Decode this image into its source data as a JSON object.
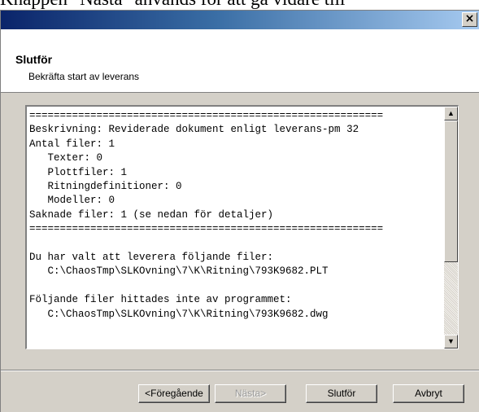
{
  "background_text": "Knappen \"Nästa\" används för att gå vidare till",
  "window": {
    "close_label": "×"
  },
  "header": {
    "title": "Slutför",
    "subtitle": "Bekräfta start av leverans"
  },
  "summary_lines": [
    "==========================================================",
    "Beskrivning: Reviderade dokument enligt leverans-pm 32",
    "Antal filer: 1",
    "   Texter: 0",
    "   Plottfiler: 1",
    "   Ritningdefinitioner: 0",
    "   Modeller: 0",
    "Saknade filer: 1 (se nedan för detaljer)",
    "==========================================================",
    "",
    "Du har valt att leverera följande filer:",
    "   C:\\ChaosTmp\\SLKOvning\\7\\K\\Ritning\\793K9682.PLT",
    "",
    "Följande filer hittades inte av programmet:",
    "   C:\\ChaosTmp\\SLKOvning\\7\\K\\Ritning\\793K9682.dwg"
  ],
  "scrollbar": {
    "up_arrow": "▲",
    "down_arrow": "▼"
  },
  "buttons": {
    "previous": "<Föregående",
    "next": "Nästa>",
    "finish": "Slutför",
    "cancel": "Avbryt"
  },
  "colors": {
    "titlebar_start": "#0a246a",
    "titlebar_end": "#a6caf0",
    "dialog_face": "#d4d0c8"
  }
}
